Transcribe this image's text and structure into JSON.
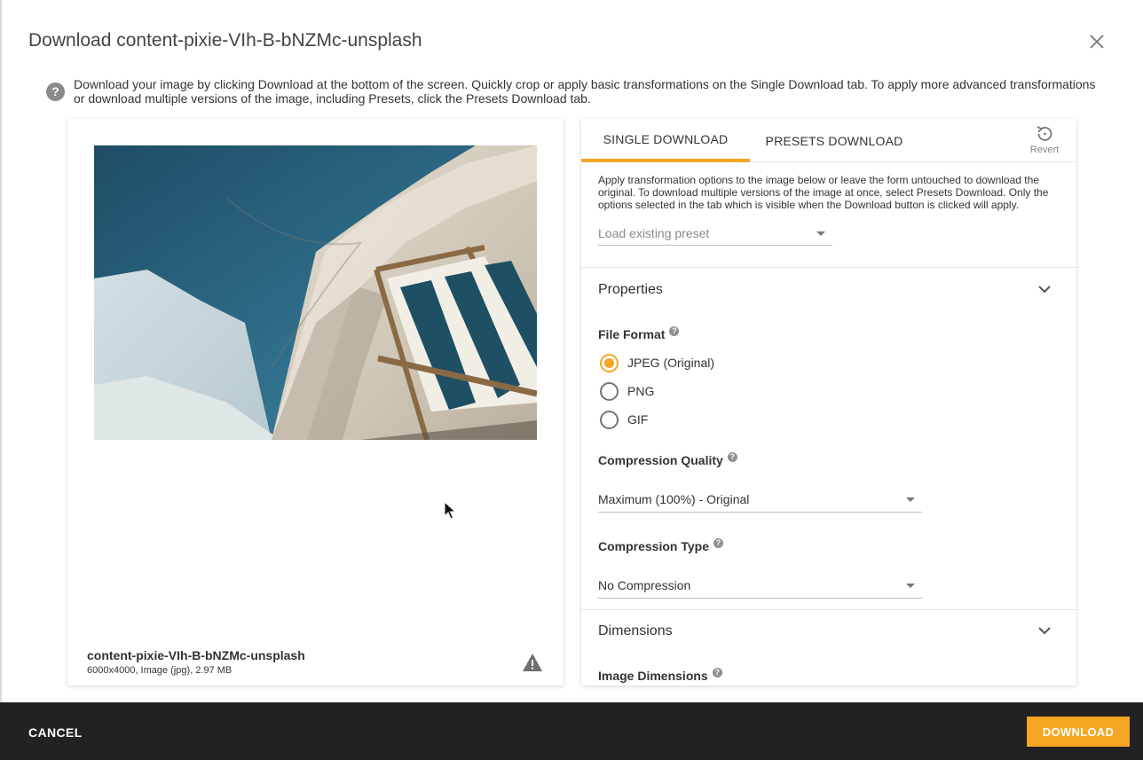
{
  "dialog": {
    "title": "Download content-pixie-VIh-B-bNZMc-unsplash",
    "info": "Download your image by clicking Download at the bottom of the screen. Quickly crop or apply basic transformations on the Single Download tab. To apply more advanced transformations or download multiple versions of the image, including Presets, click the Presets Download tab.",
    "close_icon": "close-icon",
    "help_icon": "help-circle-icon"
  },
  "preview": {
    "file_name": "content-pixie-VIh-B-bNZMc-unsplash",
    "file_meta": "6000x4000, Image (jpg), 2.97 MB",
    "warning_icon": "warning-triangle-icon"
  },
  "tabs": {
    "single": "SINGLE DOWNLOAD",
    "presets": "PRESETS DOWNLOAD",
    "revert": "Revert",
    "revert_icon": "revert-icon",
    "active": "single"
  },
  "single": {
    "description": "Apply transformation options to the image below or leave the form untouched to download the original. To download multiple versions of the image at once, select Presets Download. Only the options selected in the tab which is visible when the Download button is clicked will apply.",
    "preset_placeholder": "Load existing preset",
    "properties": {
      "title": "Properties",
      "file_format_label": "File Format",
      "formats": [
        "JPEG (Original)",
        "PNG",
        "GIF"
      ],
      "selected_format": "JPEG (Original)",
      "quality_label": "Compression Quality",
      "quality_value": "Maximum (100%) - Original",
      "type_label": "Compression Type",
      "type_value": "No Compression"
    },
    "dimensions": {
      "title": "Dimensions",
      "image_dimensions_label": "Image Dimensions"
    },
    "help_badge": "?"
  },
  "footer": {
    "cancel": "CANCEL",
    "download": "DOWNLOAD"
  },
  "colors": {
    "accent": "#f5a623",
    "footer_bg": "#222222"
  }
}
